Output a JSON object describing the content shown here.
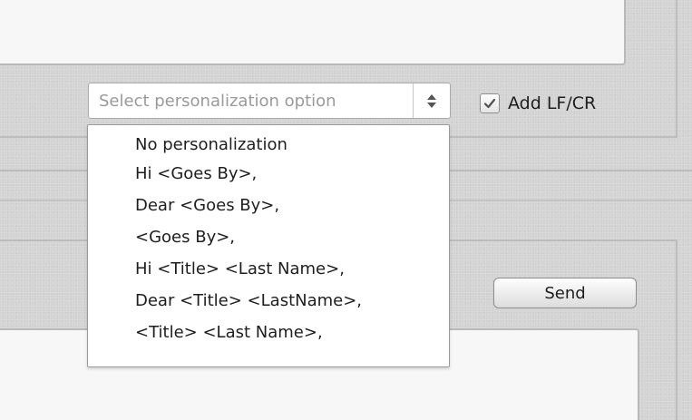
{
  "personalization": {
    "placeholder": "Select personalization option",
    "options": [
      "No personalization",
      "Hi <Goes By>,",
      "Dear <Goes By>,",
      "<Goes By>,",
      "Hi <Title> <Last Name>,",
      "Dear <Title> <LastName>,",
      "<Title> <Last Name>,"
    ]
  },
  "add_lf_cr": {
    "label": "Add LF/CR",
    "checked": true
  },
  "send": {
    "label": "Send"
  }
}
